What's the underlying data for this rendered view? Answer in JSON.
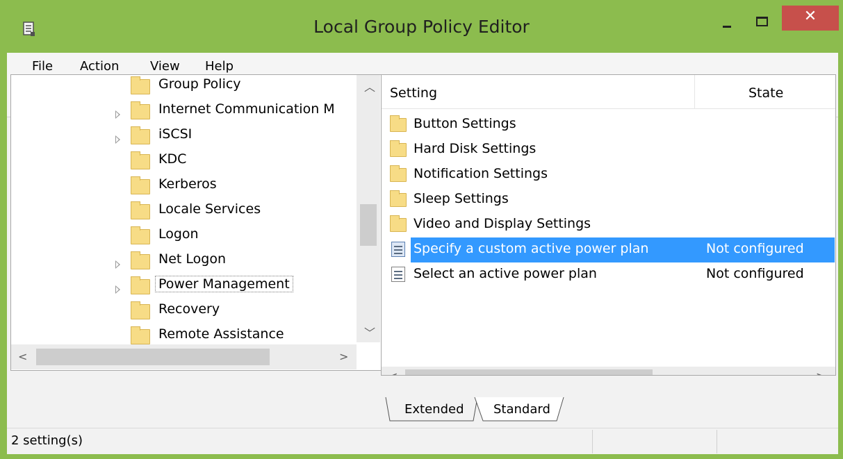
{
  "window": {
    "title": "Local Group Policy Editor",
    "close_glyph": "✕",
    "title_bar_color": "#8cbc4e",
    "close_button_color": "#c7504b"
  },
  "menu": {
    "items": [
      "File",
      "Action",
      "View",
      "Help"
    ]
  },
  "toolbar": {
    "buttons": [
      "back-arrow-icon",
      "forward-arrow-icon",
      "up-folder-icon",
      "show-hide-tree-icon",
      "export-list-icon",
      "help-icon",
      "show-hide-action-pane-icon",
      "filter-icon"
    ]
  },
  "tree": {
    "items": [
      {
        "label": "Group Policy",
        "expandable": false
      },
      {
        "label": "Internet Communication M",
        "expandable": true
      },
      {
        "label": "iSCSI",
        "expandable": true
      },
      {
        "label": "KDC",
        "expandable": false
      },
      {
        "label": "Kerberos",
        "expandable": false
      },
      {
        "label": "Locale Services",
        "expandable": false
      },
      {
        "label": "Logon",
        "expandable": false
      },
      {
        "label": "Net Logon",
        "expandable": true
      },
      {
        "label": "Power Management",
        "expandable": true,
        "focused": true
      },
      {
        "label": "Recovery",
        "expandable": false
      },
      {
        "label": "Remote Assistance",
        "expandable": false
      }
    ]
  },
  "list": {
    "columns": {
      "setting": "Setting",
      "state": "State"
    },
    "folders": [
      "Button Settings",
      "Hard Disk Settings",
      "Notification Settings",
      "Sleep Settings",
      "Video and Display Settings"
    ],
    "settings": [
      {
        "name": "Specify a custom active power plan",
        "state": "Not configured",
        "selected": true
      },
      {
        "name": "Select an active power plan",
        "state": "Not configured",
        "selected": false
      }
    ],
    "selection_color": "#3399ff"
  },
  "tabs": [
    "Extended",
    "Standard"
  ],
  "status": {
    "text": "2 setting(s)"
  }
}
